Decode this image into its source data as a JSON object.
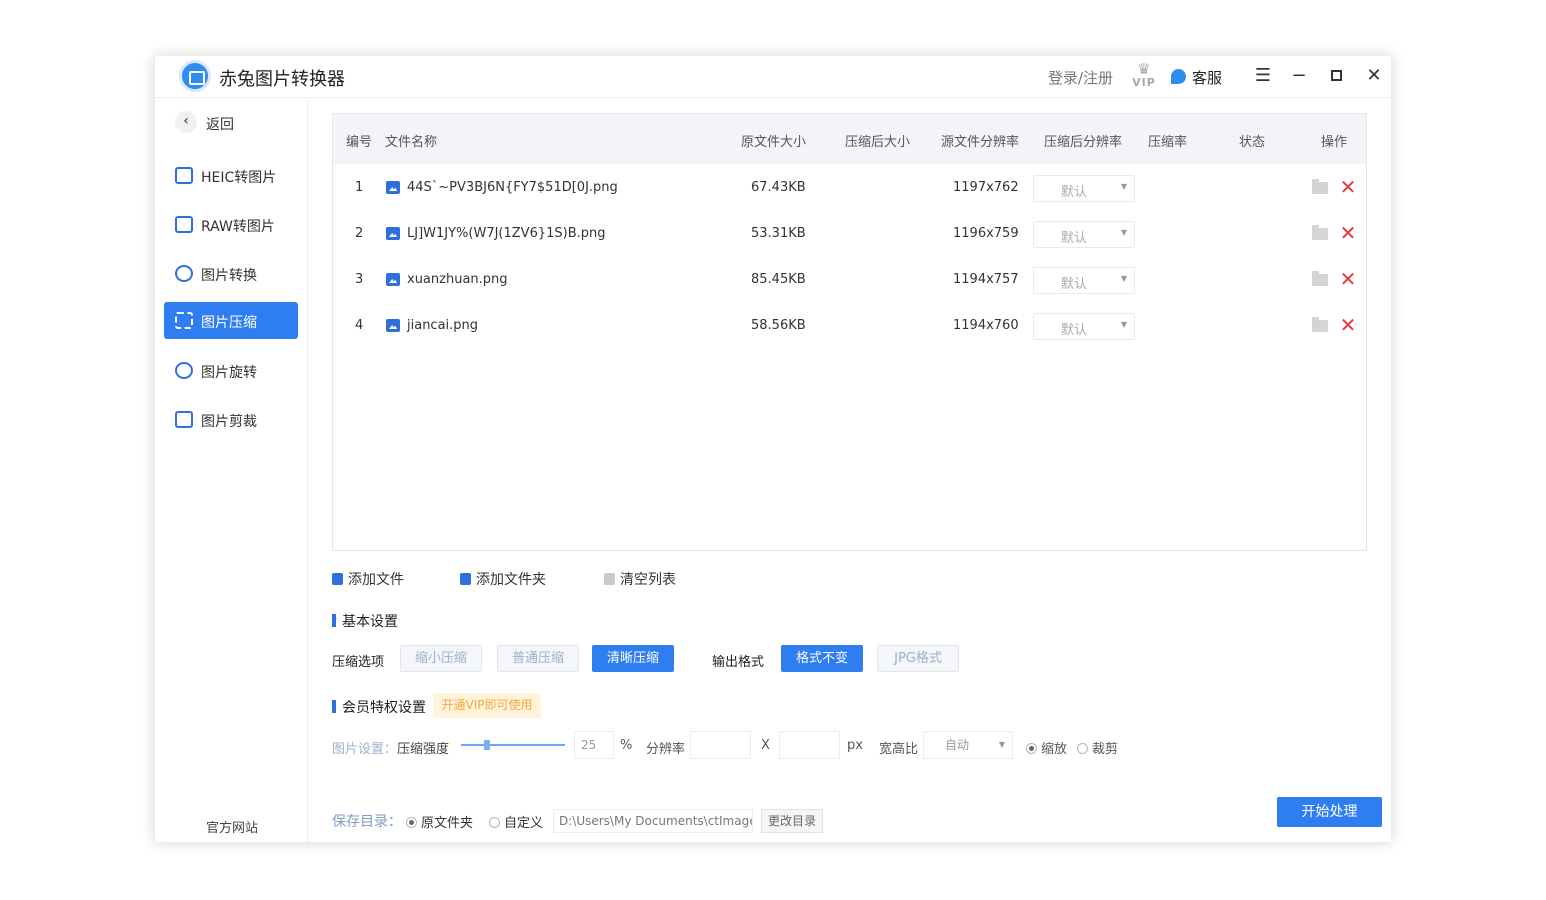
{
  "app": {
    "title": "赤兔图片转换器"
  },
  "titlebar": {
    "login": "登录/注册",
    "vip": "VIP",
    "service": "客服"
  },
  "sidebar": {
    "back": "返回",
    "items": [
      {
        "label": "HEIC转图片",
        "icon": "heic-icon",
        "active": false
      },
      {
        "label": "RAW转图片",
        "icon": "raw-icon",
        "active": false
      },
      {
        "label": "图片转换",
        "icon": "convert-icon",
        "active": false
      },
      {
        "label": "图片压缩",
        "icon": "compress-icon",
        "active": true
      },
      {
        "label": "图片旋转",
        "icon": "rotate-icon",
        "active": false
      },
      {
        "label": "图片剪裁",
        "icon": "crop-icon",
        "active": false
      }
    ],
    "website": "官方网站"
  },
  "table": {
    "headers": [
      "编号",
      "文件名称",
      "原文件大小",
      "压缩后大小",
      "源文件分辨率",
      "压缩后分辨率",
      "压缩率",
      "状态",
      "操作"
    ],
    "rows": [
      {
        "num": "1",
        "name": "44S`~PV3BJ6N{FY7$51D[0J.png",
        "size": "67.43KB",
        "res": "1197x762",
        "select": "默认"
      },
      {
        "num": "2",
        "name": "LJ]W1JY%(W7J(1ZV6}1S)B.png",
        "size": "53.31KB",
        "res": "1196x759",
        "select": "默认"
      },
      {
        "num": "3",
        "name": "xuanzhuan.png",
        "size": "85.45KB",
        "res": "1194x757",
        "select": "默认"
      },
      {
        "num": "4",
        "name": "jiancai.png",
        "size": "58.56KB",
        "res": "1194x760",
        "select": "默认"
      }
    ]
  },
  "actions": {
    "add_file": "添加文件",
    "add_folder": "添加文件夹",
    "clear": "清空列表"
  },
  "basic": {
    "title": "基本设置",
    "compress_label": "压缩选项",
    "compress_options": [
      "缩小压缩",
      "普通压缩",
      "清晰压缩"
    ],
    "compress_selected": "清晰压缩",
    "format_label": "输出格式",
    "format_options": [
      "格式不变",
      "JPG格式"
    ],
    "format_selected": "格式不变"
  },
  "vip_settings": {
    "title": "会员特权设置",
    "tag": "开通VIP即可使用",
    "image_setting": "图片设置：",
    "strength_label": "压缩强度",
    "strength_value": "25",
    "percent": "%",
    "resolution_label": "分辨率",
    "x": "X",
    "px": "px",
    "ratio_label": "宽高比",
    "ratio_value": "自动",
    "mode_options": [
      "缩放",
      "裁剪"
    ],
    "mode_selected": "缩放"
  },
  "save": {
    "label": "保存目录：",
    "options": [
      "原文件夹",
      "自定义"
    ],
    "selected": "原文件夹",
    "path": "D:\\Users\\My Documents\\ctImageC",
    "change": "更改目录"
  },
  "start_button": "开始处理",
  "colors": {
    "accent": "#2f7ef0",
    "danger": "#e03a3a",
    "vip": "#f3a93a"
  }
}
